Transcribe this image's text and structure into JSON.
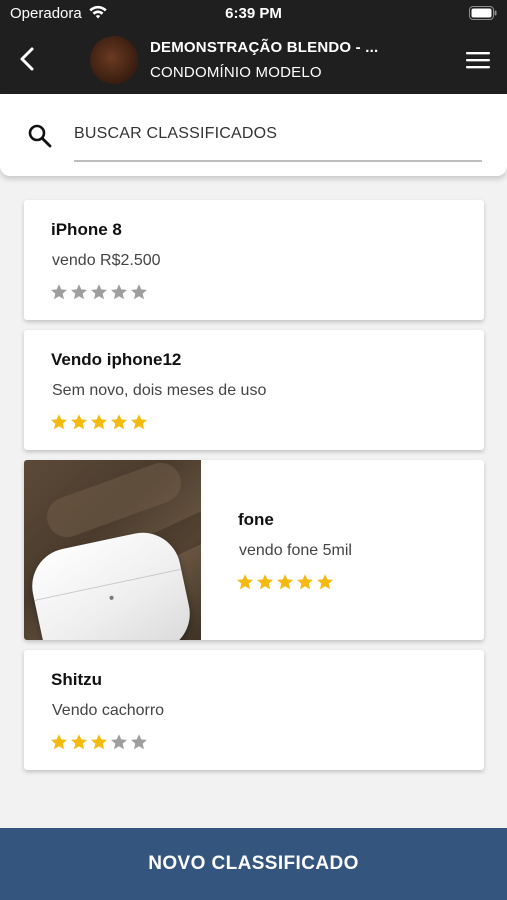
{
  "status_bar": {
    "carrier": "Operadora",
    "time": "6:39 PM"
  },
  "header": {
    "title": "DEMONSTRAÇÃO BLENDO - ...",
    "subtitle": "CONDOMÍNIO MODELO",
    "back_icon": "chevron-left-icon",
    "menu_icon": "hamburger-menu-icon"
  },
  "search": {
    "placeholder": "BUSCAR CLASSIFICADOS",
    "icon": "search-icon"
  },
  "listings": [
    {
      "title": "iPhone 8",
      "description": "vendo R$2.500",
      "rating": 0,
      "has_photo": false
    },
    {
      "title": "Vendo iphone12",
      "description": "Sem novo, dois meses de uso",
      "rating": 5,
      "has_photo": false
    },
    {
      "title": "fone",
      "description": "vendo fone 5mil",
      "rating": 5,
      "has_photo": true
    },
    {
      "title": "Shitzu",
      "description": "Vendo cachorro",
      "rating": 3,
      "has_photo": false
    }
  ],
  "max_rating": 5,
  "bottom_button": {
    "label": "NOVO CLASSIFICADO"
  },
  "colors": {
    "header_bg": "#1f1f1f",
    "star_filled": "#f5b90f",
    "star_empty": "#9e9e9e",
    "button_bg": "#34557d"
  }
}
